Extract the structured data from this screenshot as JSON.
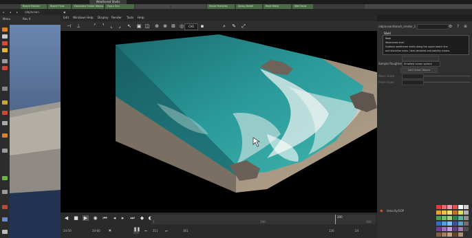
{
  "window": {
    "tooltip": "Weathered Shells"
  },
  "tabs": [
    {
      "label": "Beach Render",
      "style": "green"
    },
    {
      "label": "Beach Flow",
      "style": "green"
    },
    {
      "label": "Generate Ocean Waves",
      "style": "green"
    },
    {
      "label": "Foam Sim",
      "style": "green"
    },
    {
      "label": "",
      "style": "dark"
    },
    {
      "label": "",
      "style": "dark"
    },
    {
      "label": "Shore Particles",
      "style": "green"
    },
    {
      "label": "Spray Detail",
      "style": "green"
    },
    {
      "label": "Rock Mesh",
      "style": "green"
    },
    {
      "label": "Wet Sand",
      "style": "green"
    }
  ],
  "left_panel": {
    "tab1": "Menu",
    "tab2": "Rev 4",
    "network_label": "/obj/ocean"
  },
  "viewport_menu": [
    "Edit",
    "Windows",
    "Help",
    "Display",
    "Render",
    "Tools",
    "Help"
  ],
  "viewport": {
    "camera": "persp1",
    "zoom_field": "CH1"
  },
  "timeline": {
    "start_frame": "24-50",
    "fps": "24-60",
    "current_frame": "211",
    "end_frame": "361",
    "ticks": [
      "1",
      "100",
      "200",
      "300"
    ],
    "range_end": "126",
    "realtime": "24"
  },
  "right_panel": {
    "path": "/obj/ocean/beach_render_1",
    "node_name": "Shell",
    "tooltip_lines": [
      "Shell",
      "Weathered shell",
      "Scatters weathered shells along the upper beach line",
      "and shoreline rocks. Uses densities and wet/dry masks."
    ],
    "sample_label": "Sample Roughness",
    "sample_value": "Smallest ocean sphere",
    "button_add": "Add Ocean Waves",
    "vel_label": "Wave Scale",
    "foam_label": "Foam Scale",
    "bottom_label": "Velocity/SOP"
  },
  "colors": {
    "accent_green": "#4b6b47",
    "ocean": "#2e9e9c",
    "sand": "#b39f87"
  }
}
